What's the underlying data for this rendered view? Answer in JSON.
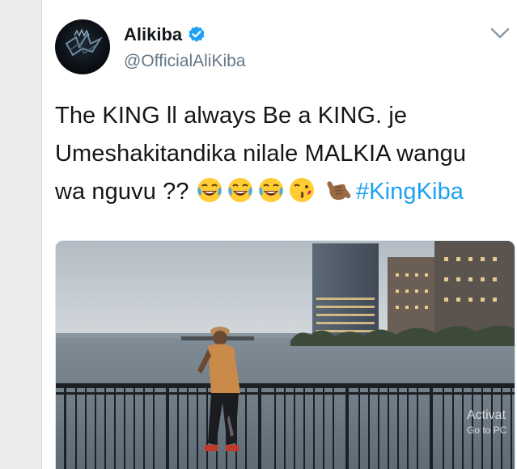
{
  "tweet": {
    "user_name": "Alikiba",
    "handle": "@OfficialAliKiba",
    "text_lines": [
      "The KING ll always Be a KING. je",
      "Umeshakitandika nilale MALKIA wangu",
      "wa nguvu ??"
    ],
    "hashtag": "#KingKiba",
    "emojis": [
      "tears-of-joy-emoji",
      "tears-of-joy-emoji",
      "tears-of-joy-emoji",
      "kissing-face-emoji",
      "call-me-hand-emoji"
    ],
    "media_description": "photo"
  },
  "overlay": {
    "activate_line1": "Activat",
    "activate_line2": "Go to PC"
  },
  "colors": {
    "verified": "#1da1f2",
    "hashtag": "#1da1f2",
    "name": "#14171a",
    "handle": "#657786"
  },
  "icons": {
    "verified": "verified-badge-icon",
    "menu": "chevron-down-icon"
  }
}
